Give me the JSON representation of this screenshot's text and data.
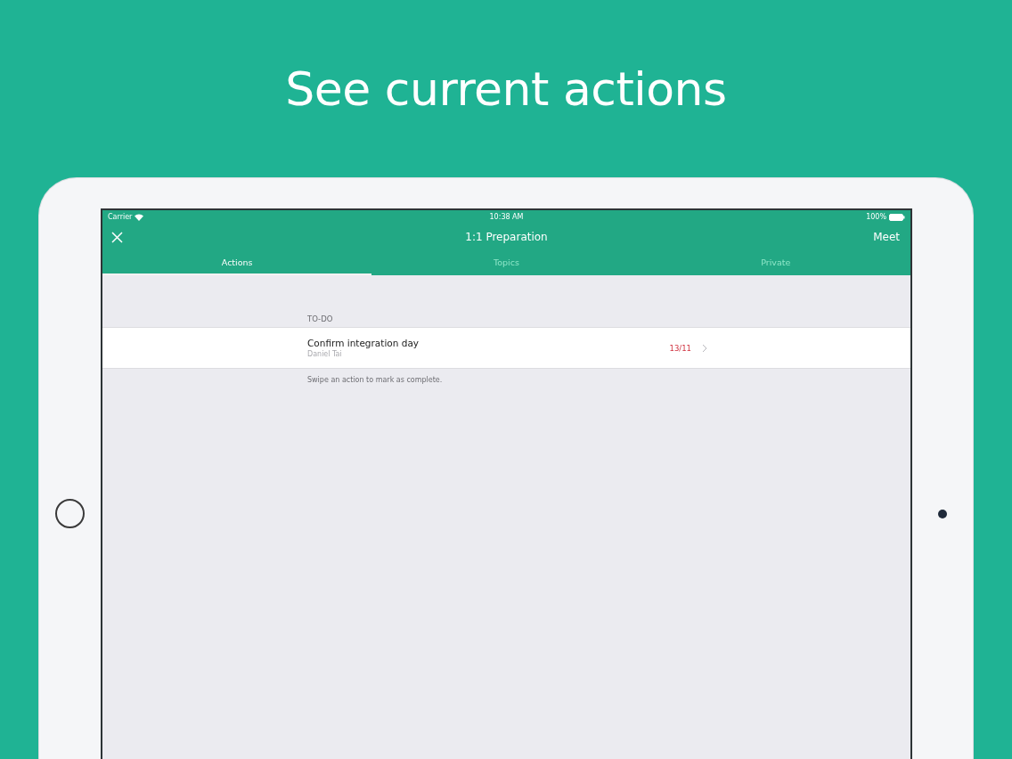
{
  "headline": "See current actions",
  "status_bar": {
    "carrier": "Carrier",
    "time": "10:38 AM",
    "battery": "100%"
  },
  "nav": {
    "title": "1:1 Preparation",
    "right_button": "Meet"
  },
  "tabs": [
    {
      "label": "Actions",
      "selected": true
    },
    {
      "label": "Topics",
      "selected": false
    },
    {
      "label": "Private",
      "selected": false
    }
  ],
  "section": {
    "header": "TO-DO",
    "rows": [
      {
        "title": "Confirm integration day",
        "subtitle": "Daniel Tai",
        "due": "13/11",
        "overdue": true
      }
    ],
    "footer": "Swipe an action to mark as complete."
  }
}
